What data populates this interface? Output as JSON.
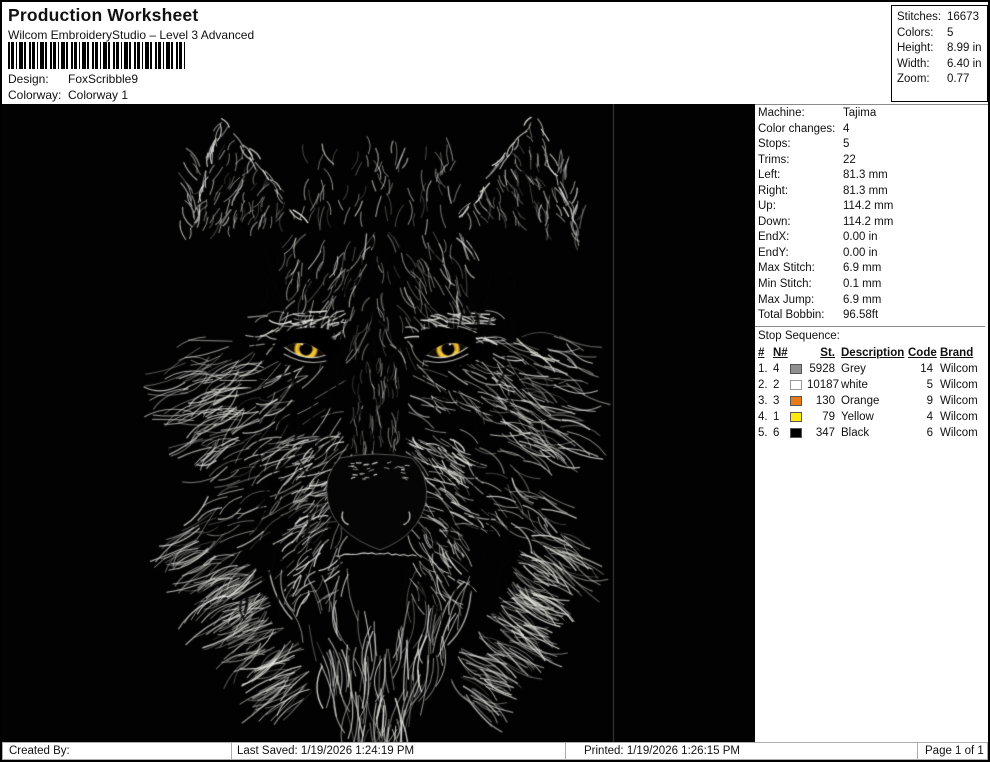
{
  "header": {
    "title": "Production Worksheet",
    "subtitle": "Wilcom EmbroideryStudio – Level 3 Advanced",
    "design_label": "Design:",
    "design_value": "FoxScribble9",
    "colorway_label": "Colorway:",
    "colorway_value": "Colorway 1"
  },
  "stats": {
    "rows": [
      {
        "label": "Stitches:",
        "value": "16673"
      },
      {
        "label": "Colors:",
        "value": "5"
      },
      {
        "label": "Height:",
        "value": "8.99 in"
      },
      {
        "label": "Width:",
        "value": "6.40 in"
      },
      {
        "label": "Zoom:",
        "value": "0.77"
      }
    ]
  },
  "machine_info": {
    "rows": [
      {
        "label": "Machine:",
        "value": "Tajima"
      },
      {
        "label": "Color changes:",
        "value": "4"
      },
      {
        "label": "Stops:",
        "value": "5"
      },
      {
        "label": "Trims:",
        "value": "22"
      },
      {
        "label": "Left:",
        "value": "81.3 mm"
      },
      {
        "label": "Right:",
        "value": "81.3 mm"
      },
      {
        "label": "Up:",
        "value": "114.2 mm"
      },
      {
        "label": "Down:",
        "value": "114.2 mm"
      },
      {
        "label": "EndX:",
        "value": "0.00 in"
      },
      {
        "label": "EndY:",
        "value": "0.00 in"
      },
      {
        "label": "Max Stitch:",
        "value": "6.9 mm"
      },
      {
        "label": "Min Stitch:",
        "value": "0.1 mm"
      },
      {
        "label": "Max Jump:",
        "value": "6.9 mm"
      },
      {
        "label": "Total Bobbin:",
        "value": "96.58ft"
      }
    ]
  },
  "stop_sequence": {
    "title": "Stop Sequence:",
    "columns": {
      "num": "#",
      "n": "N#",
      "st": "St.",
      "description": "Description",
      "code": "Code",
      "brand": "Brand"
    },
    "rows": [
      {
        "num": "1.",
        "n": "4",
        "swatch": "#8f8f8f",
        "stitches": "5928",
        "description": "Grey",
        "code": "14",
        "brand": "Wilcom"
      },
      {
        "num": "2.",
        "n": "2",
        "swatch": "#ffffff",
        "stitches": "10187",
        "description": "white",
        "code": "5",
        "brand": "Wilcom"
      },
      {
        "num": "3.",
        "n": "3",
        "swatch": "#e87c16",
        "stitches": "130",
        "description": "Orange",
        "code": "9",
        "brand": "Wilcom"
      },
      {
        "num": "4.",
        "n": "1",
        "swatch": "#ffe90e",
        "stitches": "79",
        "description": "Yellow",
        "code": "4",
        "brand": "Wilcom"
      },
      {
        "num": "5.",
        "n": "6",
        "swatch": "#000000",
        "stitches": "347",
        "description": "Black",
        "code": "6",
        "brand": "Wilcom"
      }
    ]
  },
  "footer": {
    "created_by": "Created By:",
    "last_saved": "Last Saved: 1/19/2026 1:24:19 PM",
    "printed": "Printed: 1/19/2026 1:26:15 PM",
    "page": "Page 1 of 1"
  },
  "design_preview": {
    "subject": "wolf-head-embroidery",
    "background": "#020202",
    "fur_color": "#e6e6e0",
    "eye_iris_color": "#c8951c",
    "eye_highlight_color": "#f3cc35",
    "eye_dark_color": "#6b4c0c",
    "nose_color": "#050505",
    "page_divider_color": "#3c3c3c"
  }
}
